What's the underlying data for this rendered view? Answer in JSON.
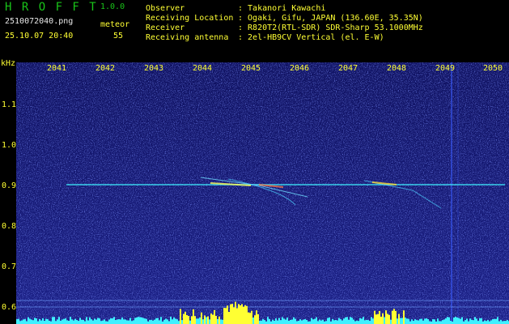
{
  "app": {
    "name": "H R O F F T",
    "version": "1.0.0",
    "filename": "2510072040.png",
    "datetime": "25.10.07 20:40",
    "count_label": "meteor",
    "count_value": "55"
  },
  "info": {
    "rows": [
      {
        "key": "Observer",
        "value": ": Takanori Kawachi"
      },
      {
        "key": "Receiving Location",
        "value": ": Ogaki, Gifu, JAPAN (136.60E, 35.35N)"
      },
      {
        "key": "Receiver",
        "value": ": R820T2(RTL-SDR) SDR-Sharp 53.1000MHz"
      },
      {
        "key": "Receiving antenna",
        "value": ": 2el-HB9CV Vertical (el. E-W)"
      }
    ]
  },
  "axis": {
    "unit": "kHz",
    "time_labels": [
      "2041",
      "2042",
      "2043",
      "2044",
      "2045",
      "2046",
      "2047",
      "2048",
      "2049",
      "2050"
    ],
    "freq_labels": [
      "1.1",
      "1.0",
      "0.9",
      "0.8",
      "0.7",
      "0.6"
    ]
  },
  "colors": {
    "background": "#000000",
    "spectrogram_bg": "#12146e",
    "title_green": "#19c419",
    "header_yellow": "#ffff33",
    "signal_cyan": "#3ff0ff"
  }
}
